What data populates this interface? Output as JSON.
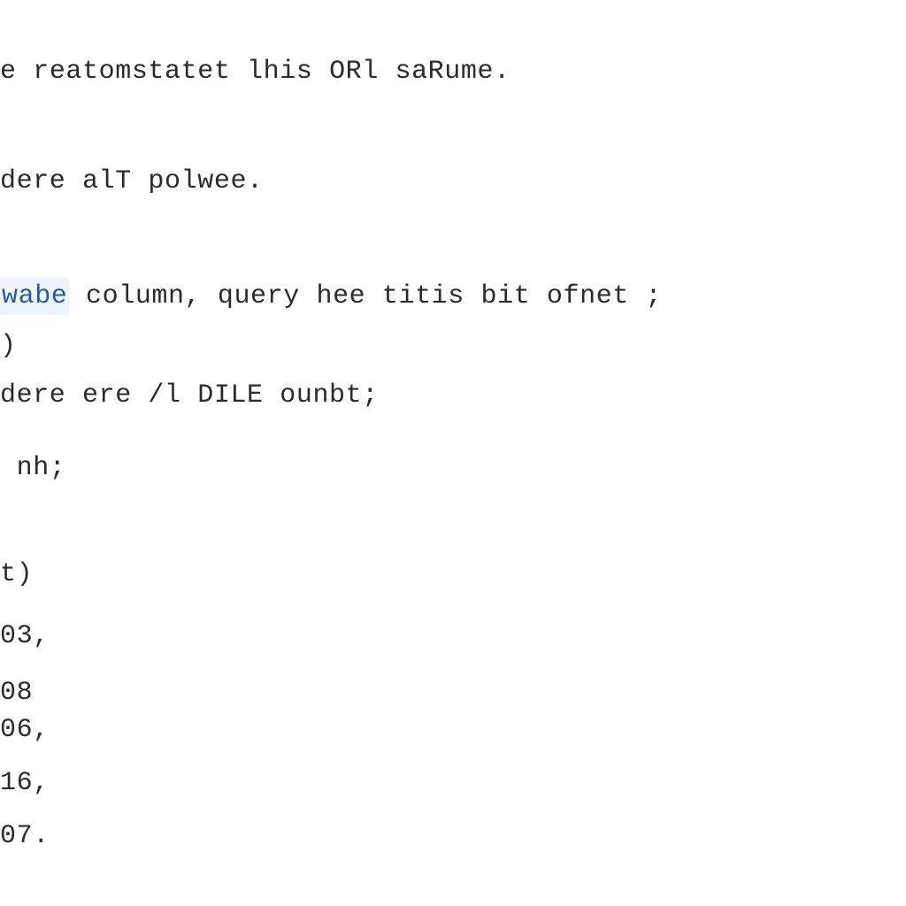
{
  "code": {
    "line1_a": "e",
    "line1_b": " reatomstatet lhis ORl saRume.",
    "line2": "dere alT polwee.",
    "line3_keyword": "wabe",
    "line3_rest": " column, query hee titis bit ofnet ;",
    "line3b": ")",
    "line4": "dere ere /l DILE ounbt;",
    "line5": " nh;",
    "line6": "t)",
    "line7": "03,",
    "line8": "08",
    "line9": "06,",
    "line10": "16,",
    "line11": "07."
  }
}
